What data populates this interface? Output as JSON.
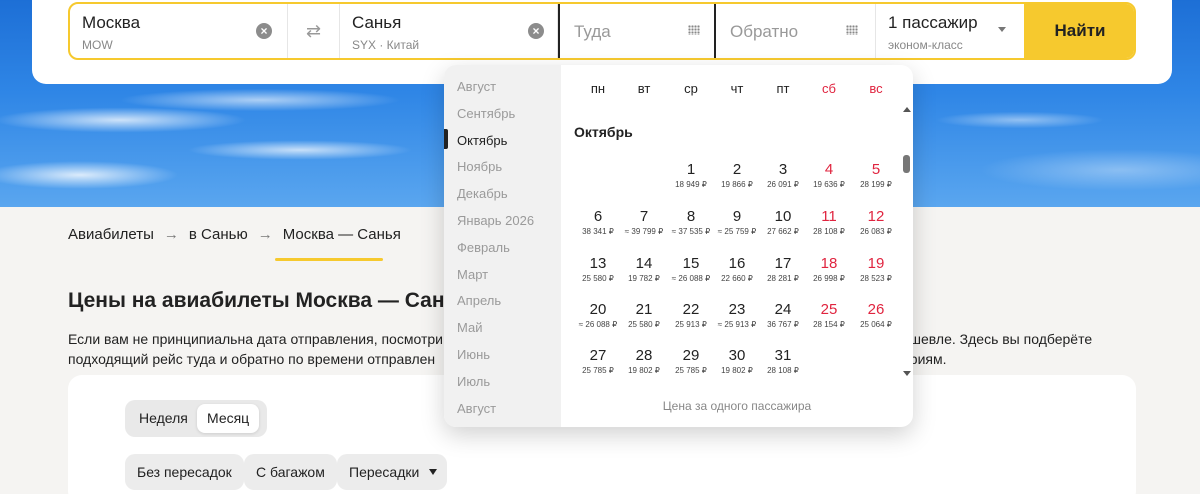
{
  "search": {
    "from_city": "Москва",
    "from_code": "MOW",
    "to_city": "Санья",
    "to_code": "SYX · Китай",
    "date_there_placeholder": "Туда",
    "date_back_placeholder": "Обратно",
    "passengers": "1 пассажир",
    "cabin": "эконом-класс",
    "find_label": "Найти"
  },
  "breadcrumb": [
    "Авиабилеты",
    "в Санью",
    "Москва — Санья"
  ],
  "heading": "Цены на авиабилеты Москва — Санья в",
  "paragraph": {
    "line1": "Если вам не принципиальна дата отправления, посмотри",
    "line1_end": "ешевле. Здесь вы подберёте",
    "line2": "подходящий рейс туда и обратно по времени отправлен",
    "line2_end": "ериям."
  },
  "view_toggle": {
    "week": "Неделя",
    "month": "Месяц"
  },
  "filters": {
    "nonstop": "Без пересадок",
    "baggage": "С багажом",
    "transfers": "Пересадки"
  },
  "calendar": {
    "months": [
      "Август",
      "Сентябрь",
      "Октябрь",
      "Ноябрь",
      "Декабрь",
      "Январь 2026",
      "Февраль",
      "Март",
      "Апрель",
      "Май",
      "Июнь",
      "Июль",
      "Август"
    ],
    "selected_month": "Октябрь",
    "weekdays": [
      "пн",
      "вт",
      "ср",
      "чт",
      "пт",
      "сб",
      "вс"
    ],
    "month_title": "Октябрь",
    "days": [
      {
        "d": "1",
        "p": "18 949 ₽"
      },
      {
        "d": "2",
        "p": "19 866 ₽"
      },
      {
        "d": "3",
        "p": "26 091 ₽"
      },
      {
        "d": "4",
        "p": "19 636 ₽"
      },
      {
        "d": "5",
        "p": "28 199 ₽"
      },
      {
        "d": "6",
        "p": "38 341 ₽"
      },
      {
        "d": "7",
        "p": "≈ 39 799 ₽"
      },
      {
        "d": "8",
        "p": "≈ 37 535 ₽"
      },
      {
        "d": "9",
        "p": "≈ 25 759 ₽"
      },
      {
        "d": "10",
        "p": "27 662 ₽"
      },
      {
        "d": "11",
        "p": "28 108 ₽"
      },
      {
        "d": "12",
        "p": "26 083 ₽"
      },
      {
        "d": "13",
        "p": "25 580 ₽"
      },
      {
        "d": "14",
        "p": "19 782 ₽"
      },
      {
        "d": "15",
        "p": "≈ 26 088 ₽"
      },
      {
        "d": "16",
        "p": "22 660 ₽"
      },
      {
        "d": "17",
        "p": "28 281 ₽"
      },
      {
        "d": "18",
        "p": "26 998 ₽"
      },
      {
        "d": "19",
        "p": "28 523 ₽"
      },
      {
        "d": "20",
        "p": "≈ 26 088 ₽"
      },
      {
        "d": "21",
        "p": "25 580 ₽"
      },
      {
        "d": "22",
        "p": "25 913 ₽"
      },
      {
        "d": "23",
        "p": "≈ 25 913 ₽"
      },
      {
        "d": "24",
        "p": "36 767 ₽"
      },
      {
        "d": "25",
        "p": "28 154 ₽"
      },
      {
        "d": "26",
        "p": "25 064 ₽"
      },
      {
        "d": "27",
        "p": "25 785 ₽"
      },
      {
        "d": "28",
        "p": "19 802 ₽"
      },
      {
        "d": "29",
        "p": "25 785 ₽"
      },
      {
        "d": "30",
        "p": "19 802 ₽"
      },
      {
        "d": "31",
        "p": "28 108 ₽"
      }
    ],
    "footer": "Цена за одного пассажира"
  },
  "colors": {
    "accent": "#f6c92e",
    "weekend": "#e0243f"
  }
}
